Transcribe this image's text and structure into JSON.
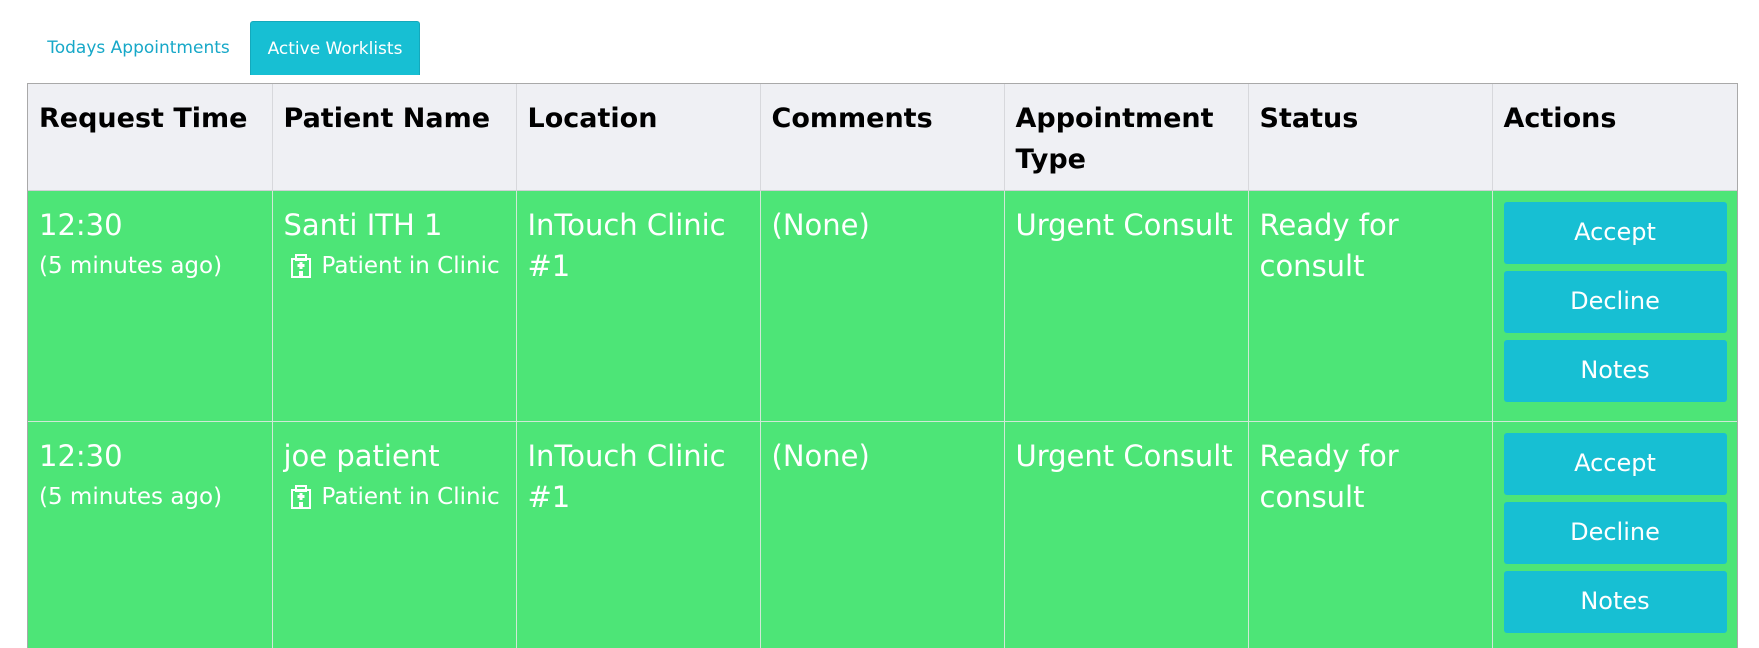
{
  "tabs": [
    {
      "label": "Todays Appointments",
      "active": false
    },
    {
      "label": "Active Worklists",
      "active": true
    }
  ],
  "table": {
    "columns": [
      "Request Time",
      "Patient Name",
      "Location",
      "Comments",
      "Appointment Type",
      "Status",
      "Actions"
    ],
    "rows": [
      {
        "time": "12:30",
        "time_ago": "(5 minutes ago)",
        "patient_name": "Santi ITH 1",
        "patient_status": "Patient in Clinic",
        "location": "InTouch Clinic #1",
        "comments": "(None)",
        "appointment_type": "Urgent Consult",
        "status": "Ready for consult",
        "actions": [
          "Accept",
          "Decline",
          "Notes"
        ]
      },
      {
        "time": "12:30",
        "time_ago": "(5 minutes ago)",
        "patient_name": "joe patient",
        "patient_status": "Patient in Clinic",
        "location": "InTouch Clinic #1",
        "comments": "(None)",
        "appointment_type": "Urgent Consult",
        "status": "Ready for consult",
        "actions": [
          "Accept",
          "Decline",
          "Notes"
        ]
      }
    ]
  },
  "colors": {
    "accent": "#17bfd3",
    "row_background": "#4de577",
    "header_background": "#eff0f4"
  },
  "icons": {
    "patient_status": "hospital-icon"
  }
}
